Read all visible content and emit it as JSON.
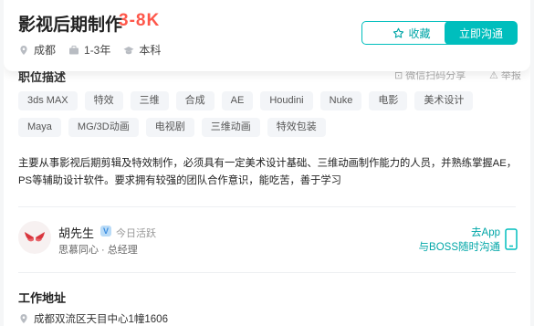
{
  "job": {
    "title": "影视后期制作",
    "salary": "3-8K",
    "city": "成都",
    "experience": "1-3年",
    "education": "本科"
  },
  "actions": {
    "favorite_label": "收藏",
    "chat_label": "立即沟通"
  },
  "section": {
    "description_title": "职位描述",
    "wechat_share": "微信扫码分享",
    "report": "举报"
  },
  "tags": [
    "3ds MAX",
    "特效",
    "三维",
    "合成",
    "AE",
    "Houdini",
    "Nuke",
    "电影",
    "美术设计",
    "Maya",
    "MG/3D动画",
    "电视剧",
    "三维动画",
    "特效包装"
  ],
  "description": "主要从事影视后期剪辑及特效制作，必须具有一定美术设计基础、三维动画制作能力的人员，并熟练掌握AE，PS等辅助设计软件。要求拥有较强的团队合作意识，能吃苦，善于学习",
  "recruiter": {
    "name": "胡先生",
    "verified_mark": "V",
    "status": "今日活跃",
    "company_title": "思慕同心 · 总经理",
    "app_line1": "去App",
    "app_line2": "与BOSS随时沟通"
  },
  "address": {
    "title": "工作地址",
    "text": "成都双流区天目中心1幢1606"
  },
  "colors": {
    "accent": "#00bebd",
    "salary": "#fe574a"
  }
}
